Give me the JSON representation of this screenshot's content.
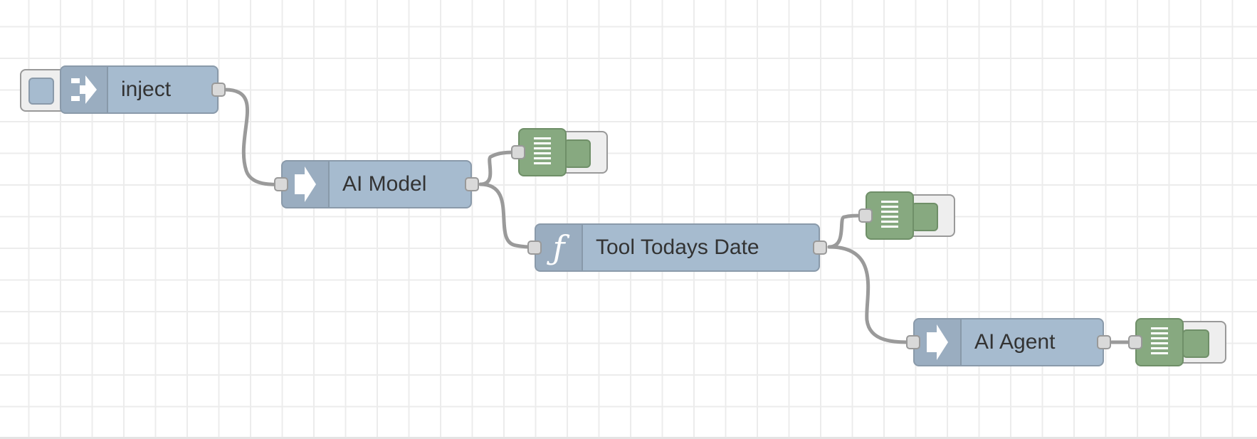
{
  "flow": {
    "nodes": [
      {
        "id": "inject",
        "type": "inject",
        "label": "inject",
        "icon": "arrow-in-icon"
      },
      {
        "id": "ai-model",
        "type": "link-in",
        "label": "AI Model",
        "icon": "arrow-right-icon"
      },
      {
        "id": "tool-todays-date",
        "type": "function",
        "label": "Tool Todays Date",
        "icon": "function-icon"
      },
      {
        "id": "ai-agent",
        "type": "link-in",
        "label": "AI Agent",
        "icon": "arrow-right-icon"
      },
      {
        "id": "debug-1",
        "type": "debug",
        "label": "",
        "icon": "list-icon"
      },
      {
        "id": "debug-2",
        "type": "debug",
        "label": "",
        "icon": "list-icon"
      },
      {
        "id": "debug-3",
        "type": "debug",
        "label": "",
        "icon": "list-icon"
      }
    ],
    "wires": [
      {
        "from": "inject",
        "to": "ai-model"
      },
      {
        "from": "ai-model",
        "to": "debug-1"
      },
      {
        "from": "ai-model",
        "to": "tool-todays-date"
      },
      {
        "from": "tool-todays-date",
        "to": "debug-2"
      },
      {
        "from": "tool-todays-date",
        "to": "ai-agent"
      },
      {
        "from": "ai-agent",
        "to": "debug-3"
      }
    ]
  },
  "colors": {
    "canvas": "#ffffff",
    "grid": "#ececec",
    "node_blue": "#a6bbcf",
    "node_green": "#87a980",
    "wire": "#9a9a9a",
    "port": "#d9d9d9"
  }
}
